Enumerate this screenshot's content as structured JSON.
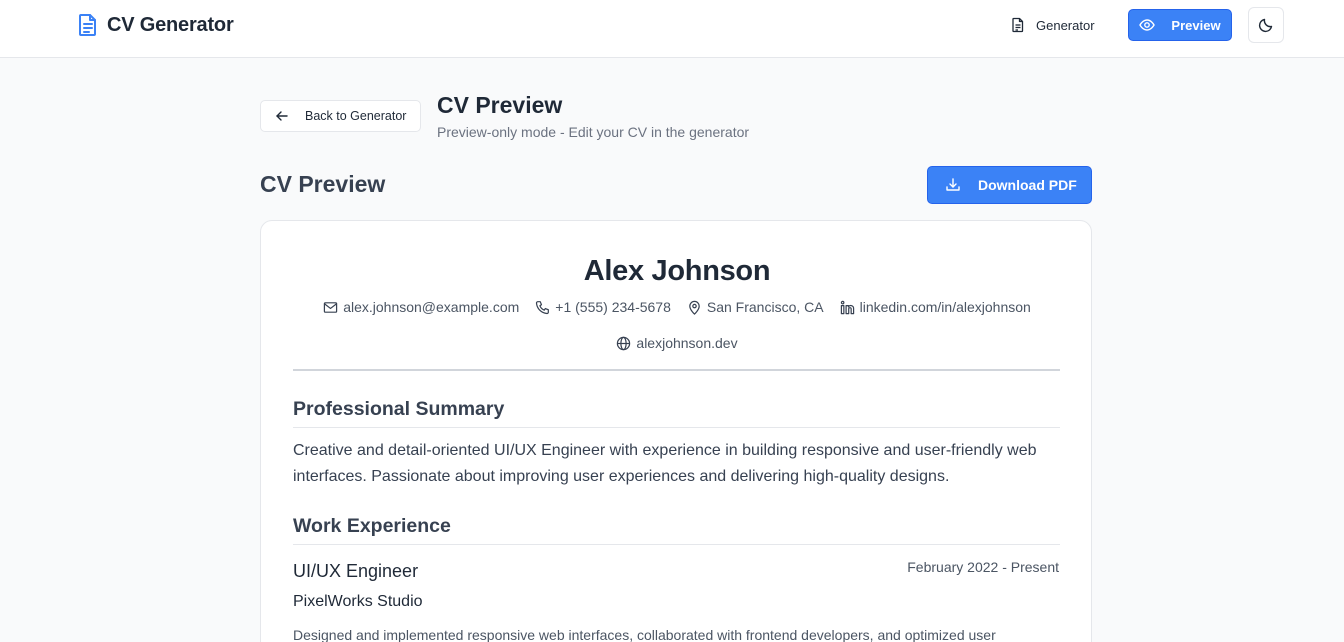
{
  "header": {
    "app_title": "CV Generator",
    "nav_generator": "Generator",
    "nav_preview": "Preview",
    "accent_color": "#3b82f6"
  },
  "page": {
    "back_label": "Back to Generator",
    "title": "CV Preview",
    "subtitle": "Preview-only mode - Edit your CV in the generator",
    "section_title": "CV Preview",
    "download_label": "Download PDF"
  },
  "cv": {
    "name": "Alex Johnson",
    "contacts": {
      "email": "alex.johnson@example.com",
      "phone": "+1 (555) 234-5678",
      "location": "San Francisco, CA",
      "linkedin": "linkedin.com/in/alexjohnson",
      "website": "alexjohnson.dev"
    },
    "summary_heading": "Professional Summary",
    "summary": "Creative and detail-oriented UI/UX Engineer with experience in building responsive and user-friendly web interfaces. Passionate about improving user experiences and delivering high-quality designs.",
    "work_heading": "Work Experience",
    "jobs": [
      {
        "title": "UI/UX Engineer",
        "company": "PixelWorks Studio",
        "dates": "February 2022 - Present",
        "description": "Designed and implemented responsive web interfaces, collaborated with frontend developers, and optimized user"
      }
    ]
  }
}
